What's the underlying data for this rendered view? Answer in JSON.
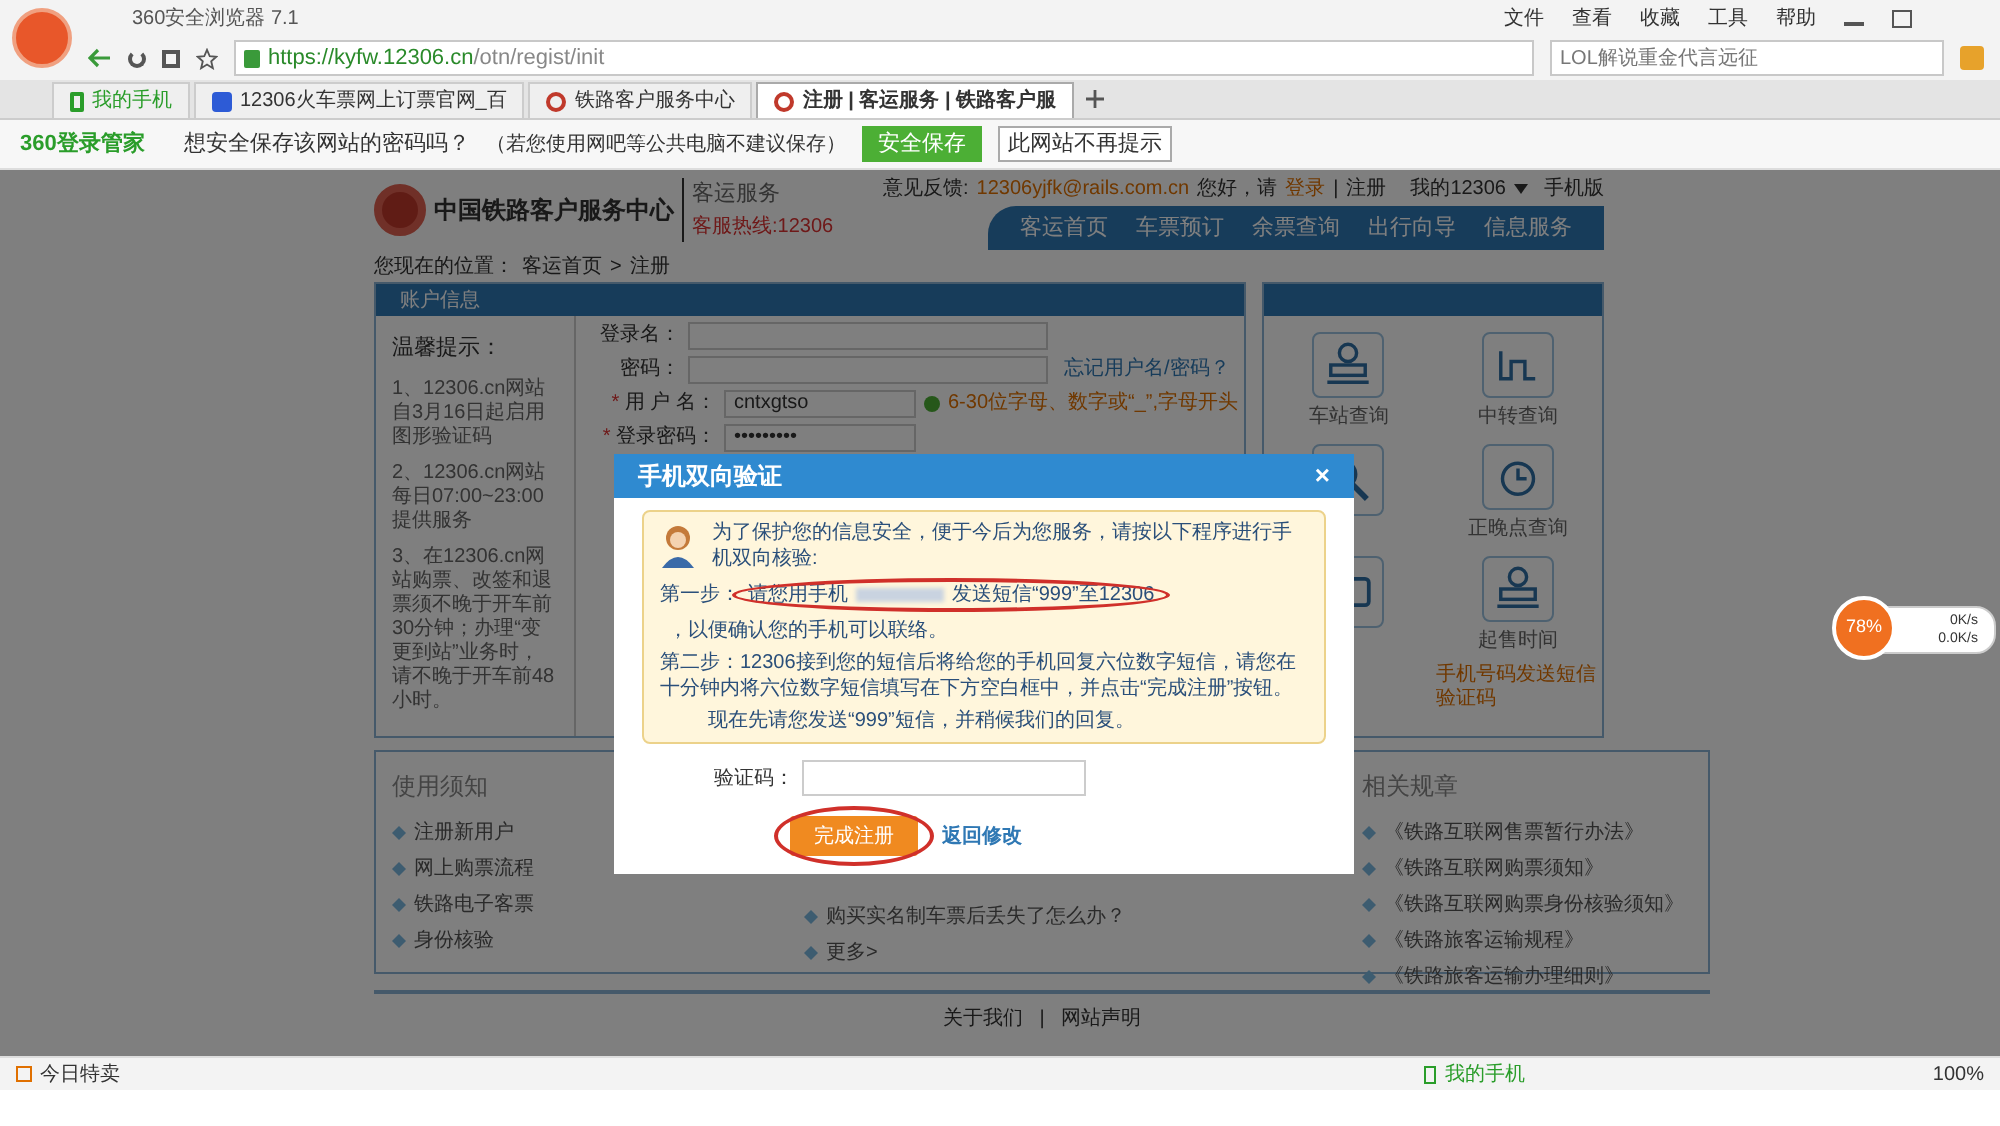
{
  "browser": {
    "title": "360安全浏览器 7.1",
    "menu": [
      "文件",
      "查看",
      "收藏",
      "工具",
      "帮助"
    ],
    "url_host": "https://kyfw.12306.cn",
    "url_path": "/otn/regist/init",
    "search_placeholder": "LOL解说重金代言远征",
    "tabs": [
      {
        "label": "我的手机",
        "selected": false,
        "kind": "phone"
      },
      {
        "label": "12306火车票网上订票官网_百",
        "selected": false,
        "kind": "paw"
      },
      {
        "label": "铁路客户服务中心",
        "selected": false,
        "kind": "rail"
      },
      {
        "label": "注册 | 客运服务 | 铁路客户服",
        "selected": true,
        "kind": "rail"
      }
    ],
    "password_bar": {
      "brand": "360登录管家",
      "question": "想安全保存该网站的密码吗？",
      "note": "（若您使用网吧等公共电脑不建议保存）",
      "save": "安全保存",
      "never": "此网站不再提示"
    }
  },
  "site": {
    "name": "中国铁路客户服务中心",
    "section": "客运服务",
    "hotline": "客服热线:12306",
    "feedback_label": "意见反馈:",
    "feedback_email": "12306yjfk@rails.com.cn",
    "greeting": "您好，请",
    "login": "登录",
    "separator": "|",
    "register": "注册",
    "my12306": "我的12306",
    "mobile": "手机版",
    "nav": [
      "客运首页",
      "车票预订",
      "余票查询",
      "出行向导",
      "信息服务"
    ]
  },
  "breadcrumb": {
    "label": "您现在的位置：",
    "home": "客运首页",
    "arrow": ">",
    "current": "注册"
  },
  "account_panel": {
    "title": "账户信息",
    "tips_title": "温馨提示：",
    "tips": [
      "1、12306.cn网站自3月16日起启用图形验证码",
      "2、12306.cn网站每日07:00~23:00提供服务",
      "3、在12306.cn网站购票、改签和退票须不晚于开车前30分钟；办理“变更到站”业务时，请不晚于开车前48小时。"
    ],
    "fields": [
      {
        "label": "登录名："
      },
      {
        "label": "密码："
      }
    ],
    "forgot": "忘记用户名/密码？",
    "required_mark": "*",
    "username_label": "用 户 名：",
    "username": "cntxgtso",
    "username_hint": "6-30位字母、数字或“_”,字母开头",
    "password_label": "登录密码：",
    "password": "•••••••••"
  },
  "services": [
    {
      "label": "车站查询",
      "kind": "station"
    },
    {
      "label": "中转查询",
      "kind": "transfer"
    },
    {
      "kind": "search"
    },
    {
      "label": "正晚点查询",
      "kind": "clock"
    },
    {
      "kind": "ticket"
    },
    {
      "label": "起售时间",
      "kind": "station"
    }
  ],
  "sms_link": "手机号码发送短信验证码",
  "columns": [
    {
      "title": "使用须知",
      "items": [
        "注册新用户",
        "网上购票流程",
        "铁路电子客票",
        "身份核验"
      ]
    },
    {
      "items": [
        "购买实名制车票后丢失了怎么办？",
        "更多>"
      ]
    },
    {
      "title": "相关规章",
      "items": [
        "《铁路互联网售票暂行办法》",
        "《铁路互联网购票须知》",
        "《铁路互联网购票身份核验须知》",
        "《铁路旅客运输规程》",
        "《铁路旅客运输办理细则》"
      ]
    }
  ],
  "footer": {
    "about": "关于我们",
    "separator": "|",
    "statement": "网站声明"
  },
  "dialog": {
    "title": "手机双向验证",
    "close": "×",
    "intro": "为了保护您的信息安全，便于今后为您服务，请按以下程序进行手机双向核验:",
    "step1_label": "第一步：",
    "step1_a": "请您用手机",
    "step1_b": "发送短信“999”至12306",
    "step1_c": "，以便确认您的手机可以联络。",
    "step2": "第二步：12306接到您的短信后将给您的手机回复六位数字短信，请您在十分钟内将六位数字短信填写在下方空白框中，并点击“完成注册”按钮。",
    "now": "现在先请您发送“999”短信，并稍候我们的回复。",
    "code_label": "验证码：",
    "submit": "完成注册",
    "back": "返回修改"
  },
  "speed_widget": {
    "percent": "78%",
    "up": "0K/s",
    "down": "0.0K/s"
  },
  "status_bar": {
    "deals": "今日特卖",
    "phone": "我的手机",
    "zoom": "100%"
  }
}
